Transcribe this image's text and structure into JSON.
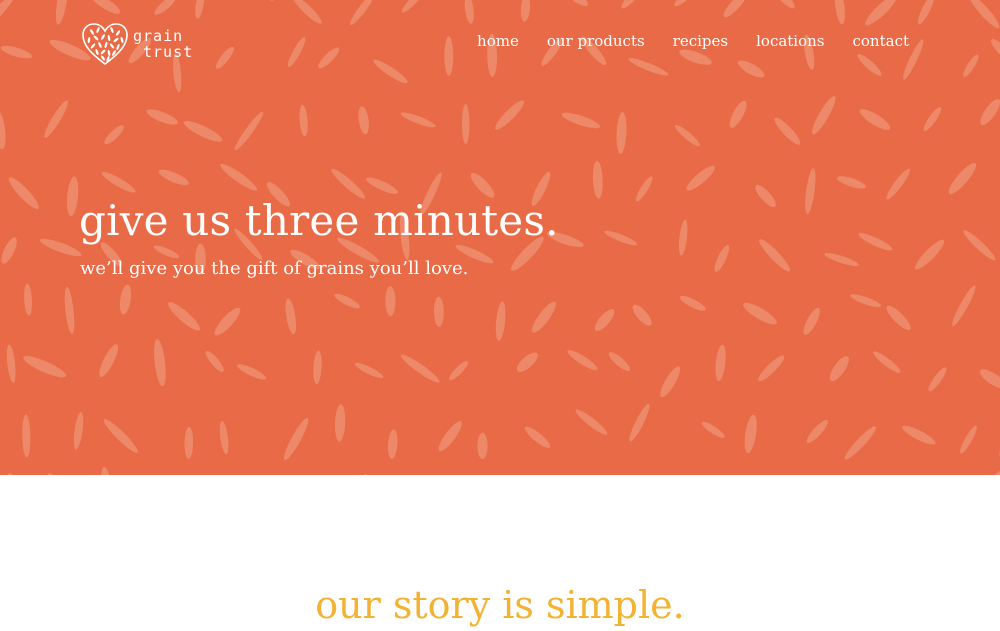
{
  "brand": {
    "logo_line1": "grain",
    "logo_line2": "trust",
    "icon": "heart-grains-icon"
  },
  "nav": {
    "items": [
      {
        "label": "home"
      },
      {
        "label": "our products"
      },
      {
        "label": "recipes"
      },
      {
        "label": "locations"
      },
      {
        "label": "contact"
      }
    ]
  },
  "hero": {
    "headline": "give us three minutes.",
    "subheadline": "we’ll give you the gift of grains you’ll love."
  },
  "story": {
    "heading": "our story is simple."
  },
  "colors": {
    "hero_bg": "#e96a46",
    "grain_pattern": "#f1a085",
    "story_heading": "#f2b233",
    "text_light": "#ffffff"
  }
}
